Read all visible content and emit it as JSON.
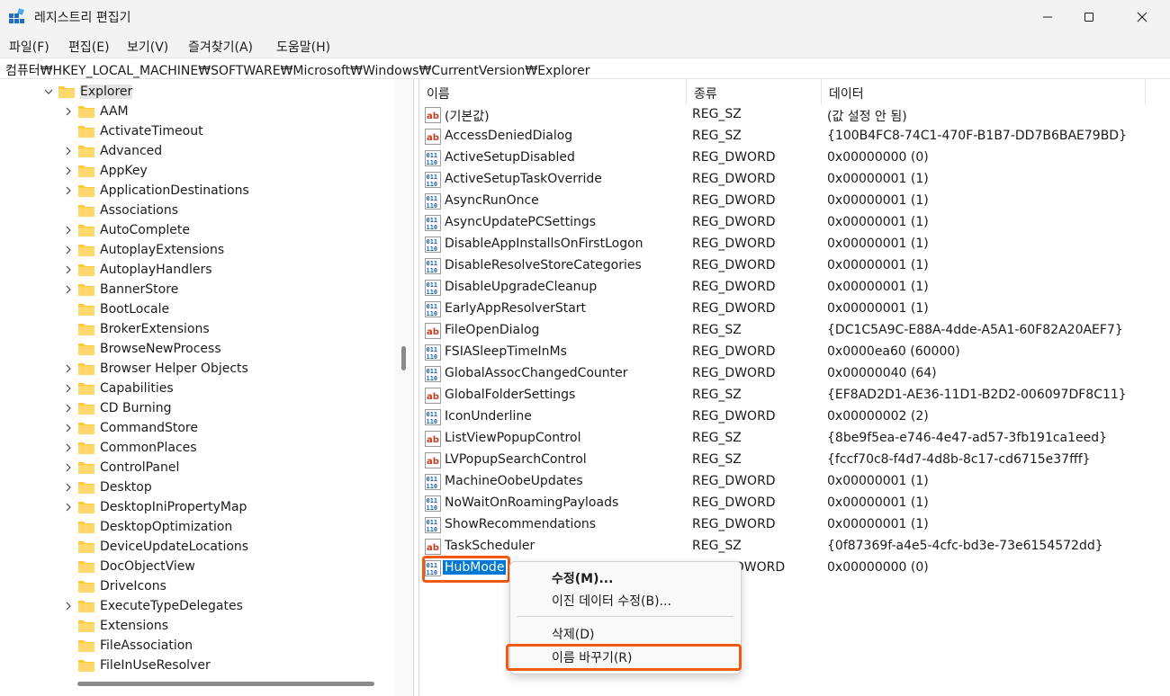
{
  "window": {
    "title": "레지스트리 편집기",
    "minimize_icon": "minimize-icon",
    "maximize_icon": "maximize-icon",
    "close_icon": "close-icon"
  },
  "menu": [
    "파일(F)",
    "편집(E)",
    "보기(V)",
    "즐겨찾기(A)",
    "도움말(H)"
  ],
  "address": "컴퓨터₩HKEY_LOCAL_MACHINE₩SOFTWARE₩Microsoft₩Windows₩CurrentVersion₩Explorer",
  "tree": {
    "parent": "Explorer",
    "children": [
      {
        "label": "AAM",
        "expandable": true
      },
      {
        "label": "ActivateTimeout",
        "expandable": false
      },
      {
        "label": "Advanced",
        "expandable": true
      },
      {
        "label": "AppKey",
        "expandable": true
      },
      {
        "label": "ApplicationDestinations",
        "expandable": true
      },
      {
        "label": "Associations",
        "expandable": false
      },
      {
        "label": "AutoComplete",
        "expandable": true
      },
      {
        "label": "AutoplayExtensions",
        "expandable": true
      },
      {
        "label": "AutoplayHandlers",
        "expandable": true
      },
      {
        "label": "BannerStore",
        "expandable": true
      },
      {
        "label": "BootLocale",
        "expandable": false
      },
      {
        "label": "BrokerExtensions",
        "expandable": false
      },
      {
        "label": "BrowseNewProcess",
        "expandable": false
      },
      {
        "label": "Browser Helper Objects",
        "expandable": true
      },
      {
        "label": "Capabilities",
        "expandable": true
      },
      {
        "label": "CD Burning",
        "expandable": true
      },
      {
        "label": "CommandStore",
        "expandable": true
      },
      {
        "label": "CommonPlaces",
        "expandable": true
      },
      {
        "label": "ControlPanel",
        "expandable": true
      },
      {
        "label": "Desktop",
        "expandable": true
      },
      {
        "label": "DesktopIniPropertyMap",
        "expandable": true
      },
      {
        "label": "DesktopOptimization",
        "expandable": false
      },
      {
        "label": "DeviceUpdateLocations",
        "expandable": false
      },
      {
        "label": "DocObjectView",
        "expandable": false
      },
      {
        "label": "DriveIcons",
        "expandable": false
      },
      {
        "label": "ExecuteTypeDelegates",
        "expandable": true
      },
      {
        "label": "Extensions",
        "expandable": false
      },
      {
        "label": "FileAssociation",
        "expandable": false
      },
      {
        "label": "FileInUseResolver",
        "expandable": false
      }
    ]
  },
  "columns": {
    "name": "이름",
    "type": "종류",
    "data": "데이터"
  },
  "values": [
    {
      "name": "(기본값)",
      "type": "REG_SZ",
      "data": "(값 설정 안 됨)",
      "icon": "string-value-icon"
    },
    {
      "name": "AccessDeniedDialog",
      "type": "REG_SZ",
      "data": "{100B4FC8-74C1-470F-B1B7-DD7B6BAE79BD}",
      "icon": "string-value-icon"
    },
    {
      "name": "ActiveSetupDisabled",
      "type": "REG_DWORD",
      "data": "0x00000000 (0)",
      "icon": "binary-value-icon"
    },
    {
      "name": "ActiveSetupTaskOverride",
      "type": "REG_DWORD",
      "data": "0x00000001 (1)",
      "icon": "binary-value-icon"
    },
    {
      "name": "AsyncRunOnce",
      "type": "REG_DWORD",
      "data": "0x00000001 (1)",
      "icon": "binary-value-icon"
    },
    {
      "name": "AsyncUpdatePCSettings",
      "type": "REG_DWORD",
      "data": "0x00000001 (1)",
      "icon": "binary-value-icon"
    },
    {
      "name": "DisableAppInstallsOnFirstLogon",
      "type": "REG_DWORD",
      "data": "0x00000001 (1)",
      "icon": "binary-value-icon"
    },
    {
      "name": "DisableResolveStoreCategories",
      "type": "REG_DWORD",
      "data": "0x00000001 (1)",
      "icon": "binary-value-icon"
    },
    {
      "name": "DisableUpgradeCleanup",
      "type": "REG_DWORD",
      "data": "0x00000001 (1)",
      "icon": "binary-value-icon"
    },
    {
      "name": "EarlyAppResolverStart",
      "type": "REG_DWORD",
      "data": "0x00000001 (1)",
      "icon": "binary-value-icon"
    },
    {
      "name": "FileOpenDialog",
      "type": "REG_SZ",
      "data": "{DC1C5A9C-E88A-4dde-A5A1-60F82A20AEF7}",
      "icon": "string-value-icon"
    },
    {
      "name": "FSIASleepTimeInMs",
      "type": "REG_DWORD",
      "data": "0x0000ea60 (60000)",
      "icon": "binary-value-icon"
    },
    {
      "name": "GlobalAssocChangedCounter",
      "type": "REG_DWORD",
      "data": "0x00000040 (64)",
      "icon": "binary-value-icon"
    },
    {
      "name": "GlobalFolderSettings",
      "type": "REG_SZ",
      "data": "{EF8AD2D1-AE36-11D1-B2D2-006097DF8C11}",
      "icon": "string-value-icon"
    },
    {
      "name": "IconUnderline",
      "type": "REG_DWORD",
      "data": "0x00000002 (2)",
      "icon": "binary-value-icon"
    },
    {
      "name": "ListViewPopupControl",
      "type": "REG_SZ",
      "data": "{8be9f5ea-e746-4e47-ad57-3fb191ca1eed}",
      "icon": "string-value-icon"
    },
    {
      "name": "LVPopupSearchControl",
      "type": "REG_SZ",
      "data": "{fccf70c8-f4d7-4d8b-8c17-cd6715e37fff}",
      "icon": "string-value-icon"
    },
    {
      "name": "MachineOobeUpdates",
      "type": "REG_DWORD",
      "data": "0x00000001 (1)",
      "icon": "binary-value-icon"
    },
    {
      "name": "NoWaitOnRoamingPayloads",
      "type": "REG_DWORD",
      "data": "0x00000001 (1)",
      "icon": "binary-value-icon"
    },
    {
      "name": "ShowRecommendations",
      "type": "REG_DWORD",
      "data": "0x00000001 (1)",
      "icon": "binary-value-icon"
    },
    {
      "name": "TaskScheduler",
      "type": "REG_SZ",
      "data": "{0f87369f-a4e5-4cfc-bd3e-73e6154572dd}",
      "icon": "string-value-icon"
    },
    {
      "name": "HubMode",
      "type": "REG_DWORD",
      "type_visible": "DWORD",
      "data": "0x00000000 (0)",
      "icon": "binary-value-icon",
      "selected": true
    }
  ],
  "context_menu": {
    "modify": "수정(M)...",
    "modify_binary": "이진 데이터 수정(B)...",
    "delete": "삭제(D)",
    "rename": "이름 바꾸기(R)"
  },
  "colors": {
    "highlight": "#f05a14",
    "selection": "#0078d4",
    "folder": "#ffc83d",
    "string_icon": "#c0392b",
    "binary_icon": "#1f5fb4"
  }
}
